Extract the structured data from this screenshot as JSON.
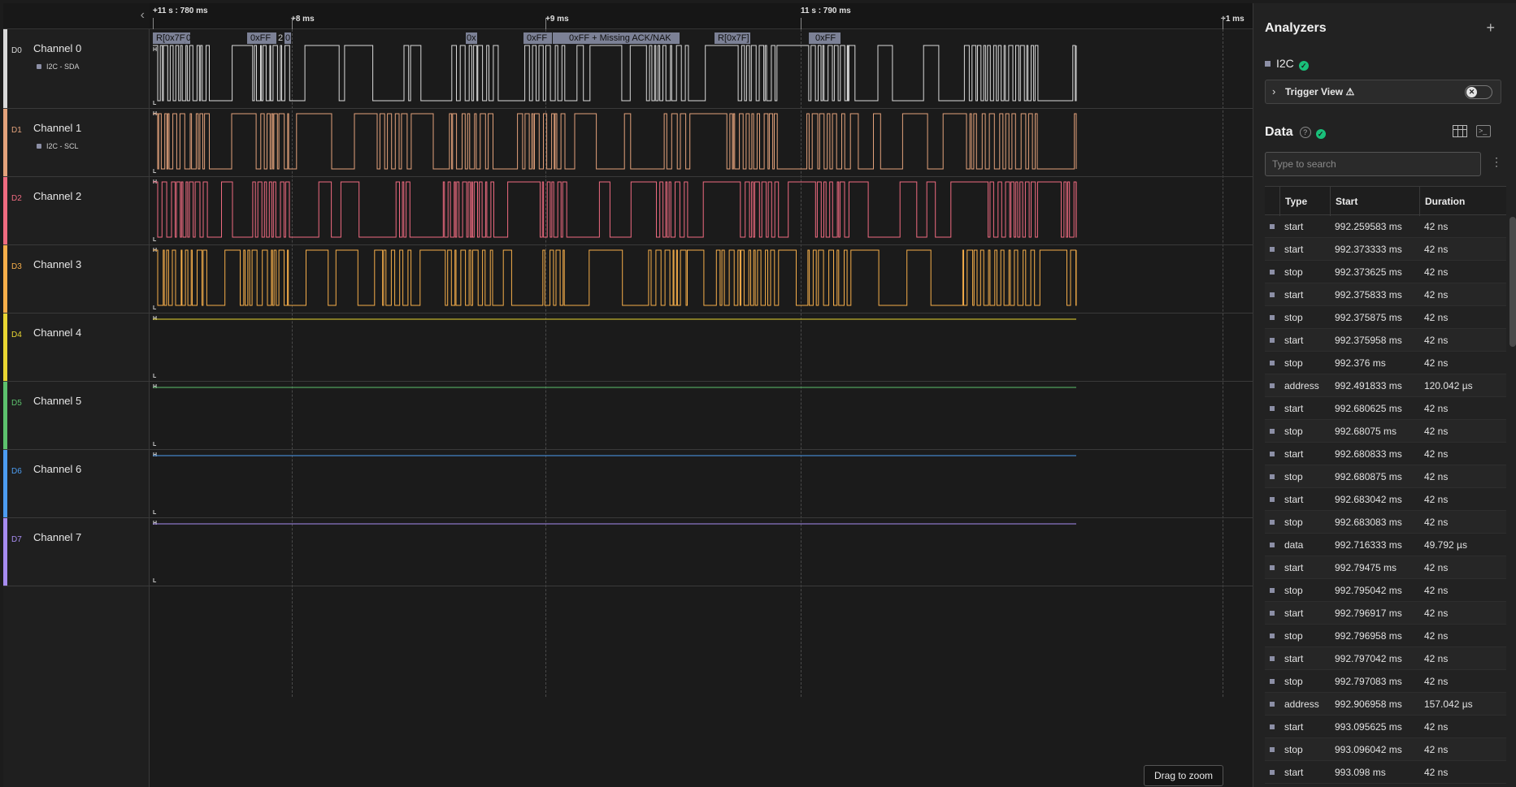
{
  "timeline": {
    "labels": [
      "+11 s : 780 ms",
      "+8 ms",
      "+9 ms",
      "11 s : 790 ms",
      "+1 ms"
    ]
  },
  "channels": [
    {
      "id": "D0",
      "name": "Channel 0",
      "sub": "I2C - SDA",
      "color": "#d9d9d9"
    },
    {
      "id": "D1",
      "name": "Channel 1",
      "sub": "I2C - SCL",
      "color": "#e3a27b"
    },
    {
      "id": "D2",
      "name": "Channel 2",
      "sub": "",
      "color": "#ef6b80"
    },
    {
      "id": "D3",
      "name": "Channel 3",
      "sub": "",
      "color": "#f6ae4a"
    },
    {
      "id": "D4",
      "name": "Channel 4",
      "sub": "",
      "color": "#e9d632"
    },
    {
      "id": "D5",
      "name": "Channel 5",
      "sub": "",
      "color": "#5cc16d"
    },
    {
      "id": "D6",
      "name": "Channel 6",
      "sub": "",
      "color": "#4c9cf0"
    },
    {
      "id": "D7",
      "name": "Channel 7",
      "sub": "",
      "color": "#a78cf0"
    }
  ],
  "level_labels": {
    "high": "H",
    "low": "L"
  },
  "protocol_frames": [
    "R[0x7F]",
    "0",
    "0xFF",
    "2",
    "0",
    "0x",
    "0xFF",
    "0xFF + Missing ACK/NAK",
    "R[0x7F]",
    "0xFF"
  ],
  "drag_to_zoom": "Drag to zoom",
  "analyzers": {
    "title": "Analyzers",
    "add": "+",
    "i2c_label": "I2C",
    "trigger_label": "Trigger View ⚠"
  },
  "data_panel": {
    "title": "Data",
    "search_placeholder": "Type to search",
    "columns": [
      "Type",
      "Start",
      "Duration"
    ],
    "rows": [
      [
        "start",
        "992.259583 ms",
        "42 ns"
      ],
      [
        "start",
        "992.373333 ms",
        "42 ns"
      ],
      [
        "stop",
        "992.373625 ms",
        "42 ns"
      ],
      [
        "start",
        "992.375833 ms",
        "42 ns"
      ],
      [
        "stop",
        "992.375875 ms",
        "42 ns"
      ],
      [
        "start",
        "992.375958 ms",
        "42 ns"
      ],
      [
        "stop",
        "992.376 ms",
        "42 ns"
      ],
      [
        "address",
        "992.491833 ms",
        "120.042 µs"
      ],
      [
        "start",
        "992.680625 ms",
        "42 ns"
      ],
      [
        "stop",
        "992.68075 ms",
        "42 ns"
      ],
      [
        "start",
        "992.680833 ms",
        "42 ns"
      ],
      [
        "stop",
        "992.680875 ms",
        "42 ns"
      ],
      [
        "start",
        "992.683042 ms",
        "42 ns"
      ],
      [
        "stop",
        "992.683083 ms",
        "42 ns"
      ],
      [
        "data",
        "992.716333 ms",
        "49.792 µs"
      ],
      [
        "start",
        "992.79475 ms",
        "42 ns"
      ],
      [
        "stop",
        "992.795042 ms",
        "42 ns"
      ],
      [
        "start",
        "992.796917 ms",
        "42 ns"
      ],
      [
        "stop",
        "992.796958 ms",
        "42 ns"
      ],
      [
        "start",
        "992.797042 ms",
        "42 ns"
      ],
      [
        "stop",
        "992.797083 ms",
        "42 ns"
      ],
      [
        "address",
        "992.906958 ms",
        "157.042 µs"
      ],
      [
        "start",
        "993.095625 ms",
        "42 ns"
      ],
      [
        "stop",
        "993.096042 ms",
        "42 ns"
      ],
      [
        "start",
        "993.098 ms",
        "42 ns"
      ]
    ]
  }
}
